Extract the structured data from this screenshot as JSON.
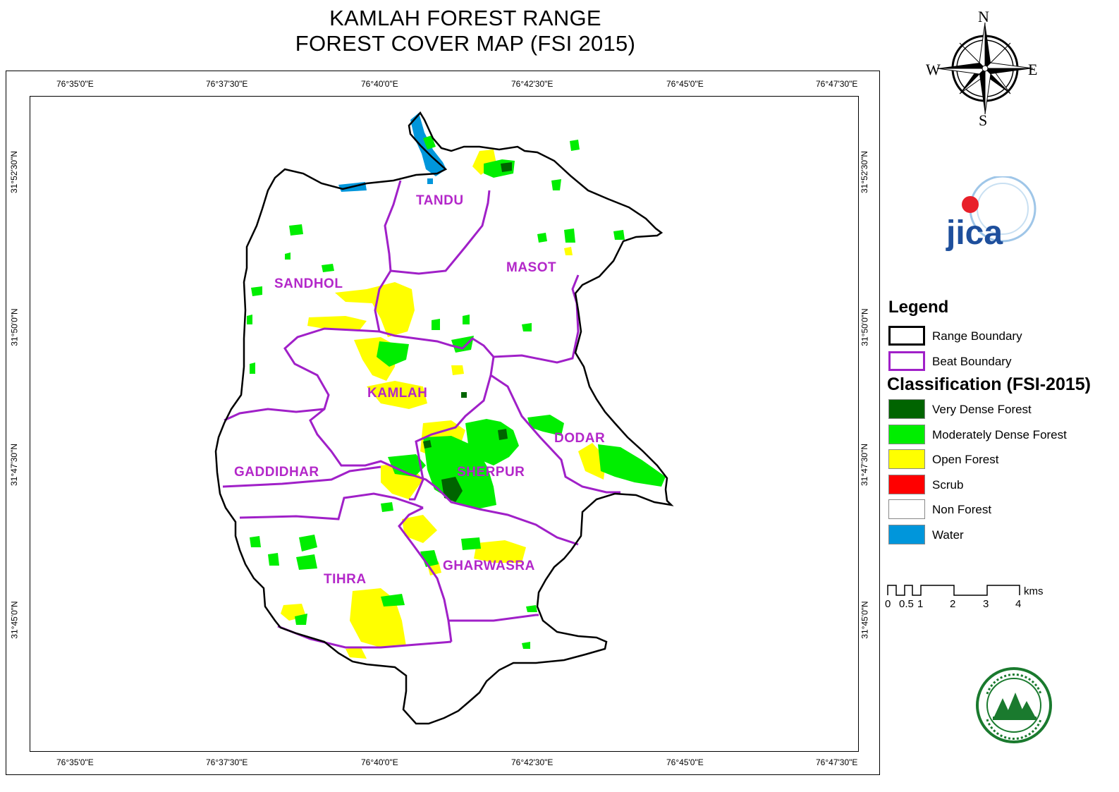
{
  "title": {
    "line1": "KAMLAH FOREST RANGE",
    "line2": "FOREST COVER MAP (FSI 2015)"
  },
  "grid": {
    "lon_labels": [
      "76°35'0\"E",
      "76°37'30\"E",
      "76°40'0\"E",
      "76°42'30\"E",
      "76°45'0\"E",
      "76°47'30\"E"
    ],
    "lat_labels": [
      "31°52'30\"N",
      "31°50'0\"N",
      "31°47'30\"N",
      "31°45'0\"N"
    ]
  },
  "beats": {
    "tandu": "TANDU",
    "masot": "MASOT",
    "sandhol": "SANDHOL",
    "kamlah": "KAMLAH",
    "dodar": "DODAR",
    "gaddidhar": "GADDIDHAR",
    "sherpur": "SHERPUR",
    "tihra": "TIHRA",
    "gharwasra": "GHARWASRA"
  },
  "compass": {
    "n": "N",
    "s": "S",
    "e": "E",
    "w": "W"
  },
  "logo": {
    "jica": "jica"
  },
  "legend": {
    "title": "Legend",
    "range_boundary": "Range Boundary",
    "beat_boundary": "Beat Boundary",
    "classification_title": "Classification (FSI-2015)",
    "classes": [
      {
        "label": "Very Dense Forest",
        "color": "#006400"
      },
      {
        "label": "Moderately Dense Forest",
        "color": "#00ee00"
      },
      {
        "label": "Open Forest",
        "color": "#ffff00"
      },
      {
        "label": "Scrub",
        "color": "#ff0000"
      },
      {
        "label": "Non Forest",
        "color": "#ffffff"
      },
      {
        "label": "Water",
        "color": "#0096db"
      }
    ]
  },
  "colors": {
    "range_boundary": "#000000",
    "beat_boundary": "#a020c8",
    "beat_label": "#b327c9"
  },
  "scale_bar": {
    "labels": [
      "0",
      "0.5",
      "1",
      "2",
      "3",
      "4"
    ],
    "unit": "kms"
  }
}
